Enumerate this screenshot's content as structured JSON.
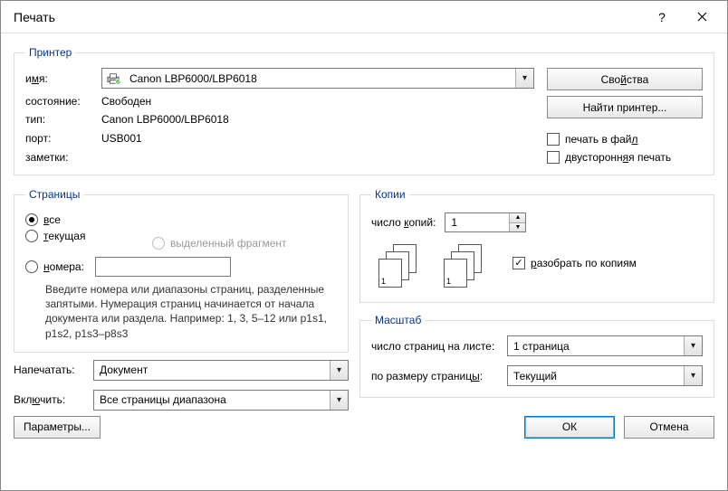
{
  "window": {
    "title": "Печать"
  },
  "printer": {
    "legend": "Принтер",
    "name_label_pre": "и",
    "name_label_u": "м",
    "name_label_post": "я:",
    "name_value": "Canon LBP6000/LBP6018",
    "state_label": "состояние:",
    "state_value": "Свободен",
    "type_label": "тип:",
    "type_value": "Canon LBP6000/LBP6018",
    "port_label": "порт:",
    "port_value": "USB001",
    "notes_label": "заметки:",
    "notes_value": "",
    "properties_btn_pre": "Сво",
    "properties_btn_u": "й",
    "properties_btn_post": "ства",
    "find_btn": "Найти принтер...",
    "print_to_file_pre": "печать в фай",
    "print_to_file_u": "л",
    "duplex_pre": "двусторонн",
    "duplex_u": "я",
    "duplex_post": "я печать"
  },
  "pages": {
    "legend": "Страницы",
    "all_u": "в",
    "all_post": "се",
    "current_u": "т",
    "current_post": "екущая",
    "selection": "выделенный фрагмент",
    "numbers_u": "н",
    "numbers_post": "омера:",
    "hint": "Введите номера или диапазоны страниц, разделенные запятыми. Нумерация страниц начинается от начала документа или раздела. Например: 1, 3, 5–12 или p1s1, p1s2, p1s3–p8s3"
  },
  "copies": {
    "legend": "Копии",
    "count_label_pre": "число ",
    "count_label_u": "к",
    "count_label_post": "опий:",
    "count_value": "1",
    "collate_u": "р",
    "collate_post": "азобрать по копиям"
  },
  "lower": {
    "print_what_label": "Напечатать:",
    "print_what_value": "Документ",
    "include_label_pre": "Вкл",
    "include_label_u": "ю",
    "include_label_post": "чить:",
    "include_value": "Все страницы диапазона"
  },
  "scale": {
    "legend": "Масштаб",
    "pages_per_sheet_label_pre": "число страниц на листе:",
    "pages_per_sheet_value": "1 страница",
    "fit_label_pre": "по размеру страниц",
    "fit_label_u": "ы",
    "fit_label_post": ":",
    "fit_value": "Текущий"
  },
  "buttons": {
    "params": "Параметры...",
    "ok": "ОК",
    "cancel": "Отмена"
  }
}
